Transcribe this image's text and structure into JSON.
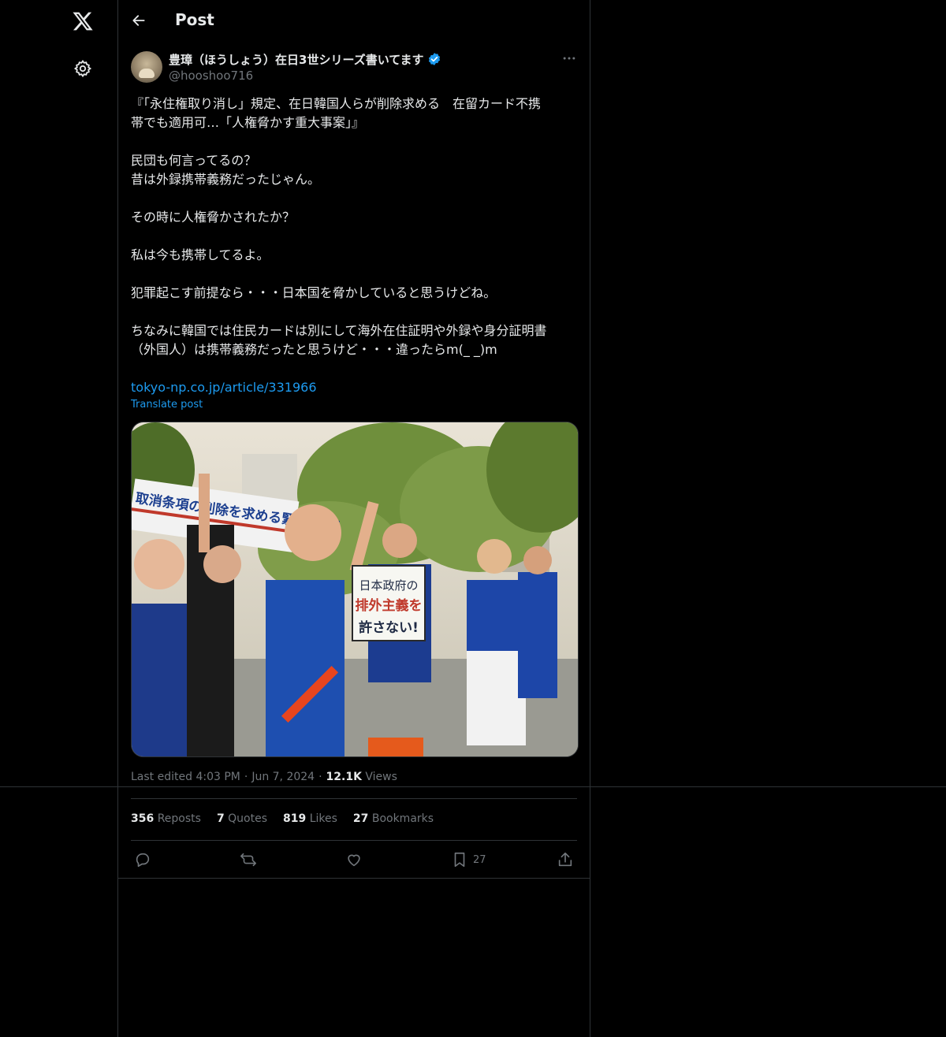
{
  "header": {
    "title": "Post"
  },
  "post": {
    "author": {
      "display_name": "豊璋（ほうしょう）在日3世シリーズ書いてます",
      "handle": "@hooshoo716",
      "verified": true
    },
    "text": "『「永住権取り消し」規定、在日韓国人らが削除求める　在留カード不携\n帯でも適用可…「人権脅かす重大事案」』\n\n民団も何言ってるの？\n昔は外録携帯義務だったじゃん。\n\nその時に人権脅かされたか？\n\n私は今も携帯してるよ。\n\n犯罪起こす前提なら・・・日本国を脅かしていると思うけどね。\n\nちなみに韓国では住民カードは別にして海外在住証明や外録や身分証明書\n（外国人）は携帯義務だったと思うけど・・・違ったらm(_ _)m",
    "link": "tokyo-np.co.jp/article/331966",
    "translate_label": "Translate post",
    "image": {
      "description": "Protest rally photo",
      "banner_text": "取消条項の削除を求める緊急集会！",
      "sign_text_1": "日本政府の",
      "sign_text_2": "排外主義を",
      "sign_text_3": "許さない!"
    },
    "meta": {
      "edited_label": "Last edited 4:03 PM",
      "date": "Jun 7, 2024",
      "views_count": "12.1K",
      "views_label": "Views"
    },
    "stats": {
      "reposts_count": "356",
      "reposts_label": "Reposts",
      "quotes_count": "7",
      "quotes_label": "Quotes",
      "likes_count": "819",
      "likes_label": "Likes",
      "bookmarks_count": "27",
      "bookmarks_label": "Bookmarks"
    },
    "actions": {
      "bookmark_count": "27"
    }
  },
  "colors": {
    "background": "#000000",
    "text": "#e7e9ea",
    "muted": "#71767b",
    "accent": "#1d9bf0",
    "border": "#2f3336"
  }
}
